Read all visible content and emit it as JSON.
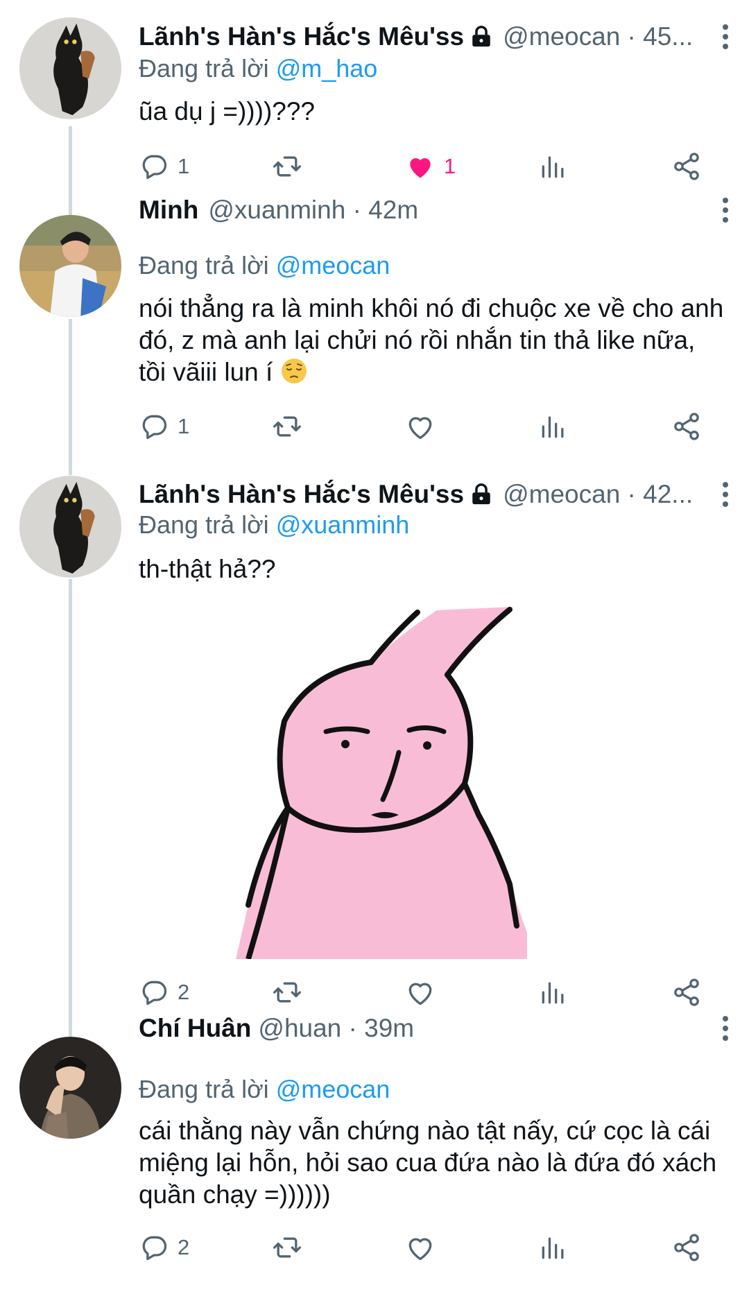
{
  "tweets": [
    {
      "name": "Lãnh's Hàn's Hắc's Mêu'ss",
      "handle_time": "@meocan · 45...",
      "replying_label": "Đang trả lời",
      "replying_to": "@m_hao",
      "text": "ũa dụ j =))))???",
      "actions": {
        "replies": "1",
        "retweets": "",
        "likes": "1",
        "liked": true
      }
    },
    {
      "name": "Minh",
      "handle_time": "@xuanminh · 42m",
      "replying_label": "Đang trả lời",
      "replying_to": "@meocan",
      "text": "nói thẳng ra là minh khôi nó đi chuộc xe về cho anh đó, z mà anh lại chửi nó rồi nhắn tin thả like nữa, tồi vãiii lun í",
      "emoji": "pensive-face",
      "actions": {
        "replies": "1",
        "retweets": "",
        "likes": "",
        "liked": false
      }
    },
    {
      "name": "Lãnh's Hàn's Hắc's Mêu'ss",
      "handle_time": "@meocan · 42...",
      "replying_label": "Đang trả lời",
      "replying_to": "@xuanminh",
      "text": "th-thật hả??",
      "media": "pink-rabbit-meme",
      "actions": {
        "replies": "2",
        "retweets": "",
        "likes": "",
        "liked": false
      }
    },
    {
      "name": "Chí Huân",
      "handle_time": "@huan · 39m",
      "replying_label": "Đang trả lời",
      "replying_to": "@meocan",
      "text": "cái thằng này vẫn chứng nào tật nấy, cứ cọc là cái miệng lại hỗn, hỏi sao cua đứa nào là đứa đó xách quần chạy =))))))",
      "actions": {
        "replies": "2",
        "retweets": "",
        "likes": "",
        "liked": false
      }
    }
  ],
  "colors": {
    "accent": "#1d9bf0",
    "like": "#f91880",
    "secondary": "#536471"
  },
  "icons": [
    "reply-icon",
    "retweet-icon",
    "like-icon",
    "views-icon",
    "share-icon",
    "more-icon",
    "lock-icon"
  ]
}
